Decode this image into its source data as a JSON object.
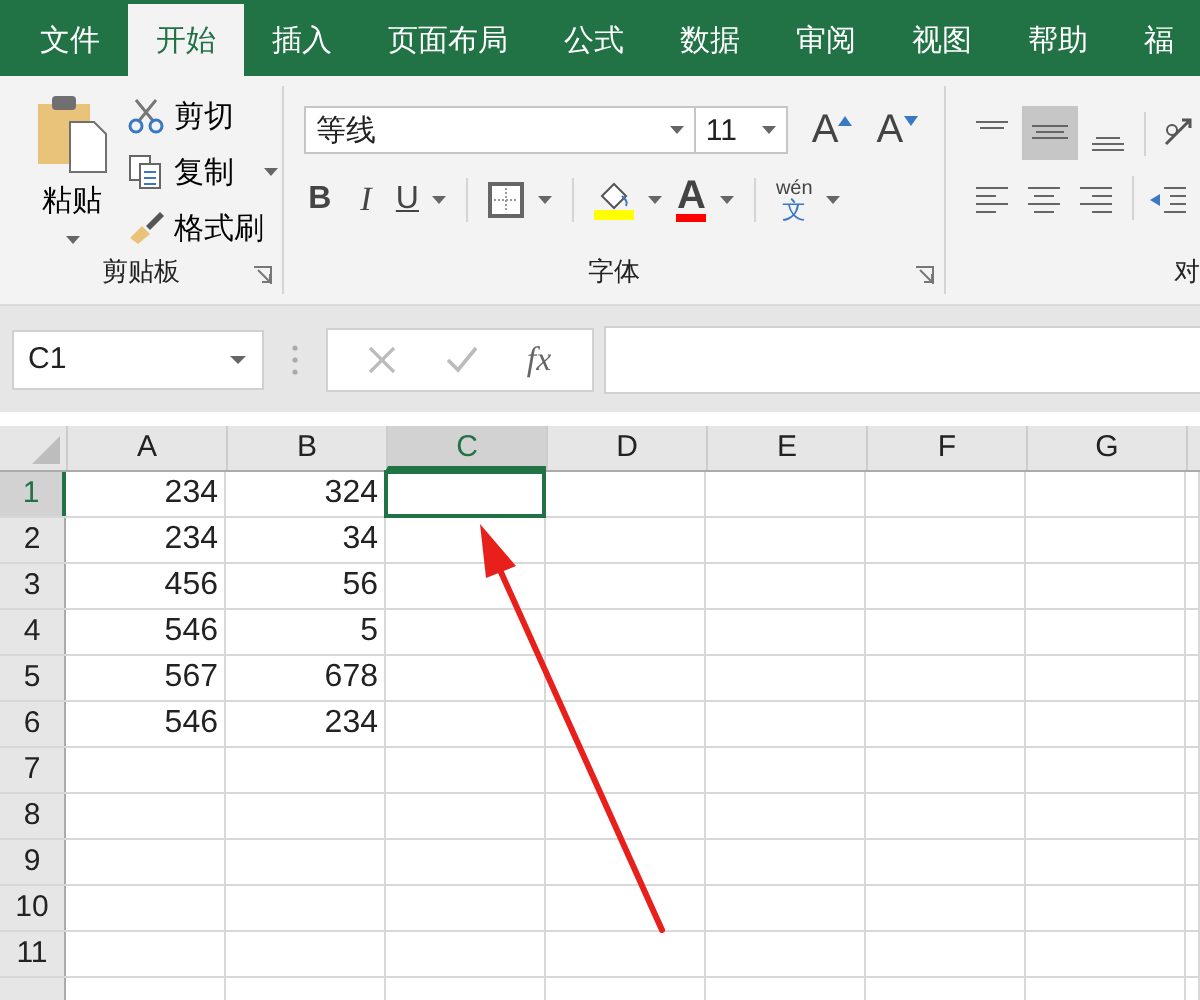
{
  "tabs": [
    {
      "label": "文件",
      "selected": false
    },
    {
      "label": "开始",
      "selected": true
    },
    {
      "label": "插入",
      "selected": false
    },
    {
      "label": "页面布局",
      "selected": false
    },
    {
      "label": "公式",
      "selected": false
    },
    {
      "label": "数据",
      "selected": false
    },
    {
      "label": "审阅",
      "selected": false
    },
    {
      "label": "视图",
      "selected": false
    },
    {
      "label": "帮助",
      "selected": false
    },
    {
      "label": "福",
      "selected": false
    }
  ],
  "clipboard": {
    "paste": "粘贴",
    "cut": "剪切",
    "copy": "复制",
    "format_painter": "格式刷",
    "group_label": "剪贴板"
  },
  "font": {
    "font_name": "等线",
    "font_size": "11",
    "phonetic": "wén",
    "phonetic_char": "文",
    "bold": "B",
    "italic": "I",
    "underline": "U",
    "grow": "A",
    "shrink": "A",
    "font_color_letter": "A",
    "group_label": "字体"
  },
  "alignment": {
    "group_label": "对",
    "middle_align_selected": true
  },
  "formula_bar": {
    "name_box": "C1",
    "fx": "fx"
  },
  "sheet": {
    "columns": [
      {
        "label": "A",
        "selected": false
      },
      {
        "label": "B",
        "selected": false
      },
      {
        "label": "C",
        "selected": true
      },
      {
        "label": "D",
        "selected": false
      },
      {
        "label": "E",
        "selected": false
      },
      {
        "label": "F",
        "selected": false
      },
      {
        "label": "G",
        "selected": false
      }
    ],
    "rows": [
      {
        "number": "1",
        "selected": true,
        "cells": [
          "234",
          "324"
        ]
      },
      {
        "number": "2",
        "selected": false,
        "cells": [
          "234",
          "34"
        ]
      },
      {
        "number": "3",
        "selected": false,
        "cells": [
          "456",
          "56"
        ]
      },
      {
        "number": "4",
        "selected": false,
        "cells": [
          "546",
          "5"
        ]
      },
      {
        "number": "5",
        "selected": false,
        "cells": [
          "567",
          "678"
        ]
      },
      {
        "number": "6",
        "selected": false,
        "cells": [
          "546",
          "234"
        ]
      },
      {
        "number": "7",
        "selected": false,
        "cells": []
      },
      {
        "number": "8",
        "selected": false,
        "cells": []
      },
      {
        "number": "9",
        "selected": false,
        "cells": []
      },
      {
        "number": "10",
        "selected": false,
        "cells": []
      },
      {
        "number": "11",
        "selected": false,
        "cells": []
      }
    ]
  },
  "annotation": {
    "kind": "arrow"
  }
}
